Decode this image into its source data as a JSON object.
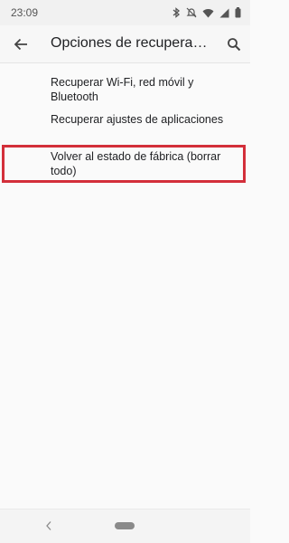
{
  "status_bar": {
    "time": "23:09",
    "icons": [
      "bluetooth-icon",
      "do-not-disturb-off-icon",
      "wifi-icon",
      "signal-icon",
      "battery-icon"
    ]
  },
  "app_bar": {
    "title": "Opciones de recuperaci...",
    "back_icon": "arrow-back-icon",
    "search_icon": "search-icon"
  },
  "options": [
    {
      "label": "Recuperar Wi-Fi, red móvil y Bluetooth"
    },
    {
      "label": "Recuperar ajustes de aplicaciones"
    },
    {
      "label": "Volver al estado de fábrica (borrar todo)",
      "highlighted": true
    }
  ],
  "colors": {
    "highlight_border": "#d32f3a",
    "background": "#fafafa",
    "text": "#202124"
  },
  "nav_bar": {
    "back_icon": "nav-back-icon",
    "home_icon": "home-pill-icon"
  }
}
